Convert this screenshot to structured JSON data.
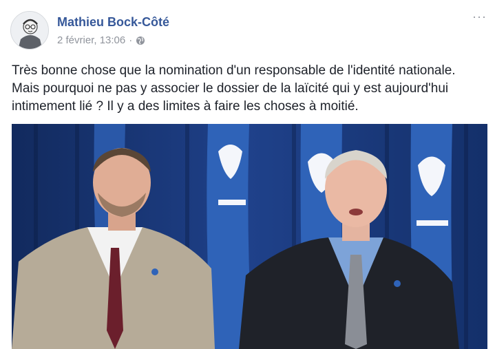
{
  "post": {
    "author_name": "Mathieu Bock-Côté",
    "timestamp": "2 février, 13:06",
    "separator": "·",
    "privacy_icon": "globe-icon",
    "more_icon": "more-options-icon",
    "more_label": "···",
    "text_lines": [
      "Très bonne chose que la nomination d'un responsable de l'identité nationale.",
      "Mais pourquoi ne pas y associer le dossier de la laïcité qui y est aujourd'hui",
      "intimement lié ? Il y a des limites à faire les choses à moitié."
    ],
    "photo": {
      "description_icon": "press-conference-photo",
      "colors": {
        "curtain": "#1b3b7d",
        "flag_blue": "#2f63b8",
        "flag_white": "#f4f6fb"
      }
    }
  },
  "colors": {
    "author": "#365899",
    "meta": "#90949c",
    "body_text": "#1d2129"
  }
}
